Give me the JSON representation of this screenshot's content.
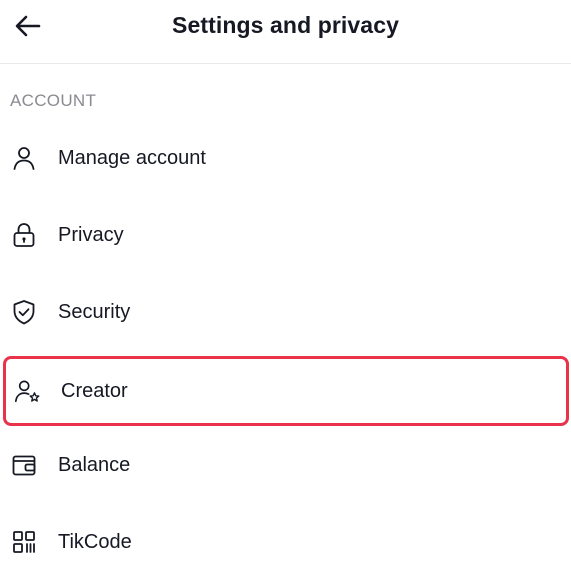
{
  "header": {
    "back_icon": "arrow-left-icon",
    "title": "Settings and privacy"
  },
  "section": {
    "label": "ACCOUNT"
  },
  "items": [
    {
      "label": "Manage account",
      "icon": "person-icon"
    },
    {
      "label": "Privacy",
      "icon": "lock-icon"
    },
    {
      "label": "Security",
      "icon": "shield-check-icon"
    },
    {
      "label": "Creator",
      "icon": "person-star-icon",
      "highlighted": true
    },
    {
      "label": "Balance",
      "icon": "wallet-icon"
    },
    {
      "label": "TikCode",
      "icon": "qr-code-icon"
    }
  ],
  "colors": {
    "text": "#161823",
    "muted": "#8a8b91",
    "highlight_border": "#e8334a",
    "icon_stroke": "#161823"
  }
}
